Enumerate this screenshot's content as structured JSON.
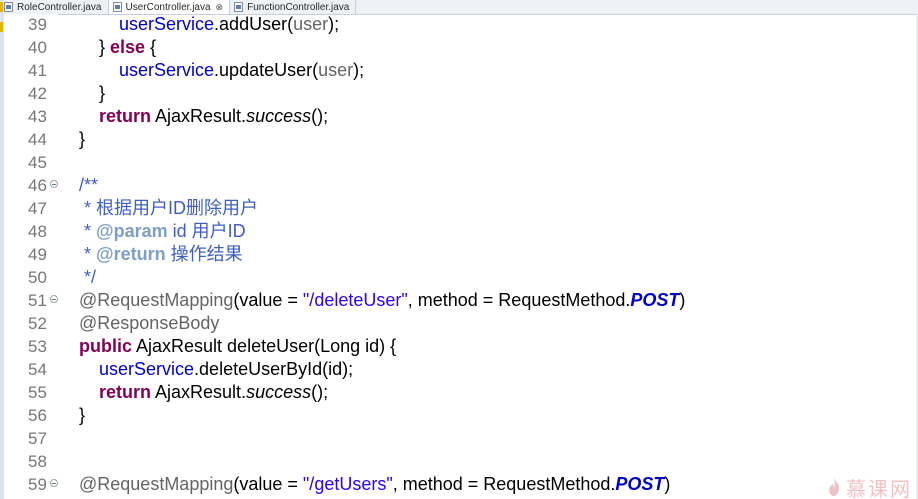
{
  "tabs": [
    {
      "label": "RoleController.java",
      "active": false
    },
    {
      "label": "UserController.java",
      "active": true,
      "close": "⊗"
    },
    {
      "label": "FunctionController.java",
      "active": false
    }
  ],
  "lines": [
    {
      "num": "39",
      "indent": 119,
      "segments": [
        {
          "t": "userService",
          "c": "fld"
        },
        {
          "t": ".addUser(",
          "c": "plain"
        },
        {
          "t": "user",
          "c": "ann"
        },
        {
          "t": ");",
          "c": "plain"
        }
      ]
    },
    {
      "num": "40",
      "indent": 99,
      "segments": [
        {
          "t": "} ",
          "c": "plain"
        },
        {
          "t": "else",
          "c": "kw"
        },
        {
          "t": " {",
          "c": "plain"
        }
      ]
    },
    {
      "num": "41",
      "indent": 119,
      "segments": [
        {
          "t": "userService",
          "c": "fld"
        },
        {
          "t": ".updateUser(",
          "c": "plain"
        },
        {
          "t": "user",
          "c": "ann"
        },
        {
          "t": ");",
          "c": "plain"
        }
      ]
    },
    {
      "num": "42",
      "indent": 99,
      "segments": [
        {
          "t": "}",
          "c": "plain"
        }
      ]
    },
    {
      "num": "43",
      "indent": 99,
      "segments": [
        {
          "t": "return",
          "c": "kw"
        },
        {
          "t": " AjaxResult.",
          "c": "plain"
        },
        {
          "t": "success",
          "c": "ital"
        },
        {
          "t": "();",
          "c": "plain"
        }
      ]
    },
    {
      "num": "44",
      "indent": 79,
      "segments": [
        {
          "t": "}",
          "c": "plain"
        }
      ]
    },
    {
      "num": "45",
      "indent": 79,
      "segments": []
    },
    {
      "num": "46",
      "indent": 79,
      "fold": true,
      "segments": [
        {
          "t": "/**",
          "c": "cmt"
        }
      ]
    },
    {
      "num": "47",
      "indent": 84,
      "segments": [
        {
          "t": "* 根据用户ID删除用户",
          "c": "cmt"
        }
      ]
    },
    {
      "num": "48",
      "indent": 84,
      "segments": [
        {
          "t": "* ",
          "c": "cmt"
        },
        {
          "t": "@param",
          "c": "tag"
        },
        {
          "t": " id 用户ID",
          "c": "cmt"
        }
      ]
    },
    {
      "num": "49",
      "indent": 84,
      "segments": [
        {
          "t": "* ",
          "c": "cmt"
        },
        {
          "t": "@return",
          "c": "tag"
        },
        {
          "t": " 操作结果",
          "c": "cmt"
        }
      ]
    },
    {
      "num": "50",
      "indent": 84,
      "segments": [
        {
          "t": "*/",
          "c": "cmt"
        }
      ]
    },
    {
      "num": "51",
      "indent": 79,
      "fold": true,
      "segments": [
        {
          "t": "@RequestMapping",
          "c": "ann"
        },
        {
          "t": "(value = ",
          "c": "plain"
        },
        {
          "t": "\"/deleteUser\"",
          "c": "str"
        },
        {
          "t": ", method = RequestMethod.",
          "c": "plain"
        },
        {
          "t": "POST",
          "c": "enumc"
        },
        {
          "t": ")",
          "c": "plain"
        }
      ]
    },
    {
      "num": "52",
      "indent": 79,
      "segments": [
        {
          "t": "@ResponseBody",
          "c": "ann"
        }
      ]
    },
    {
      "num": "53",
      "indent": 79,
      "segments": [
        {
          "t": "public",
          "c": "kw"
        },
        {
          "t": " AjaxResult deleteUser(Long id) {",
          "c": "plain"
        }
      ]
    },
    {
      "num": "54",
      "indent": 99,
      "segments": [
        {
          "t": "userService",
          "c": "fld"
        },
        {
          "t": ".deleteUserById(id);",
          "c": "plain"
        }
      ]
    },
    {
      "num": "55",
      "indent": 99,
      "segments": [
        {
          "t": "return",
          "c": "kw"
        },
        {
          "t": " AjaxResult.",
          "c": "plain"
        },
        {
          "t": "success",
          "c": "ital"
        },
        {
          "t": "();",
          "c": "plain"
        }
      ]
    },
    {
      "num": "56",
      "indent": 79,
      "segments": [
        {
          "t": "}",
          "c": "plain"
        }
      ]
    },
    {
      "num": "57",
      "indent": 79,
      "segments": []
    },
    {
      "num": "58",
      "indent": 79,
      "segments": []
    },
    {
      "num": "59",
      "indent": 79,
      "fold": true,
      "segments": [
        {
          "t": "@RequestMapping",
          "c": "ann"
        },
        {
          "t": "(value = ",
          "c": "plain"
        },
        {
          "t": "\"/getUsers\"",
          "c": "str"
        },
        {
          "t": ", method = RequestMethod.",
          "c": "plain"
        },
        {
          "t": "POST",
          "c": "enumc"
        },
        {
          "t": ")",
          "c": "plain"
        }
      ]
    }
  ],
  "watermark": {
    "text": "慕课网",
    "icon": "flame-icon"
  },
  "colors": {
    "keyword": "#7f0055",
    "field": "#0000c0",
    "string": "#2a00ff",
    "annotation": "#646464",
    "comment": "#3f5fbf",
    "javadoc_tag": "#7f9fbf"
  }
}
